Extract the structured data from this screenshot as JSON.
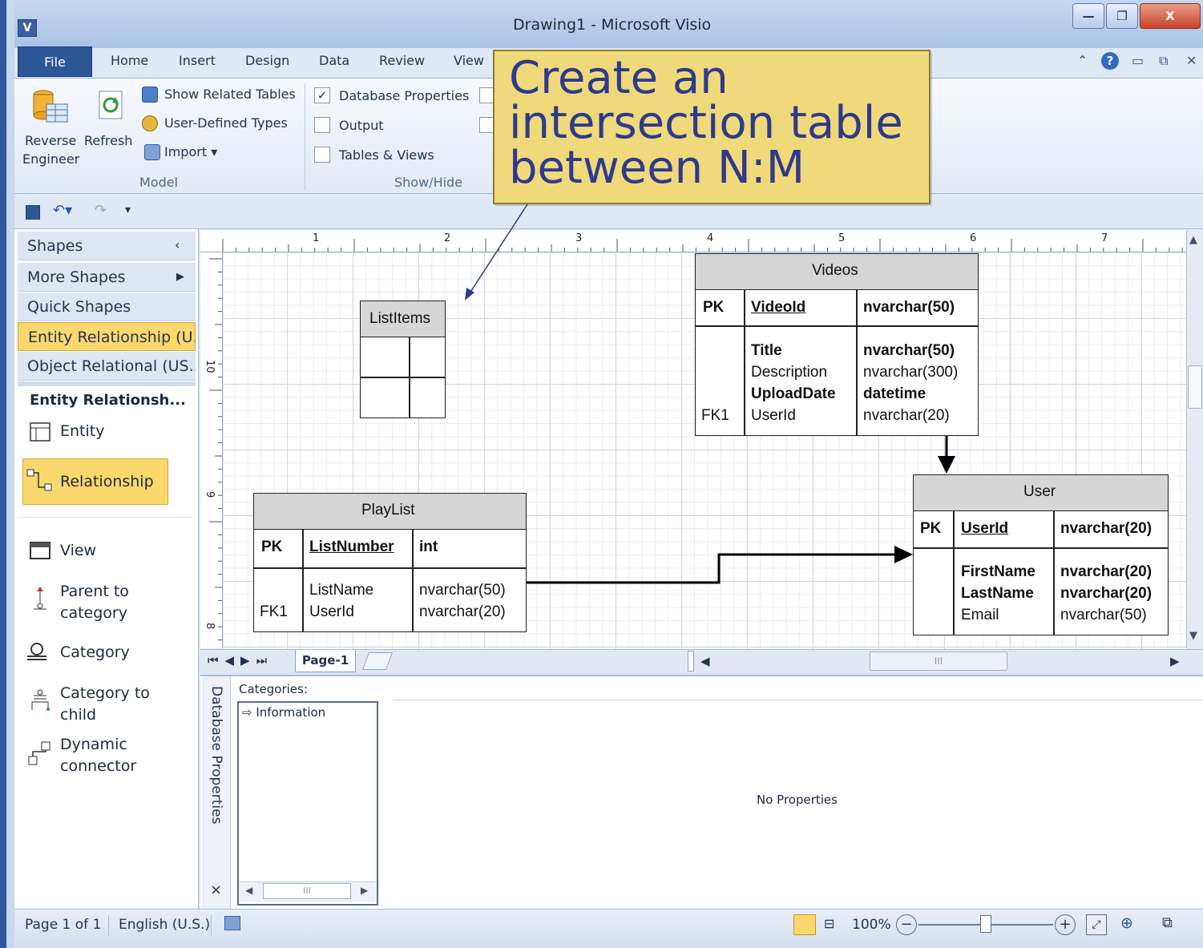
{
  "window": {
    "title": "Drawing1  -  Microsoft Visio",
    "app_icon": "V",
    "min": "—",
    "max": "❐",
    "close": "X"
  },
  "ribbon_tabs": [
    "File",
    "Home",
    "Insert",
    "Design",
    "Data",
    "Review",
    "View"
  ],
  "ribbon": {
    "reverse_engineer": [
      "Reverse",
      "Engineer"
    ],
    "refresh": "Refresh",
    "show_related_tables": "Show Related Tables",
    "user_defined_types": "User-Defined Types",
    "import": "Import ▾",
    "group_model": "Model",
    "database_properties": "Database Properties",
    "output": "Output",
    "tables_views": "Tables & Views",
    "group_showhide": "Show/Hide",
    "database_properties_checked": true
  },
  "callout": {
    "lines": [
      "Create an",
      "intersection table",
      "between N:M"
    ]
  },
  "shapes_pane": {
    "header": "Shapes",
    "more_shapes": "More Shapes",
    "quick_shapes": "Quick Shapes",
    "stencil_active": "Entity Relationship (U...",
    "stencil_other": "Object Relational (US...",
    "section_title": "Entity Relationsh...",
    "items": [
      {
        "name": "entity",
        "label": "Entity"
      },
      {
        "name": "relationship",
        "label": "Relationship"
      },
      {
        "name": "view",
        "label": "View"
      },
      {
        "name": "parent-to-category",
        "label1": "Parent to",
        "label2": "category"
      },
      {
        "name": "category",
        "label": "Category"
      },
      {
        "name": "category-to-child",
        "label1": "Category to",
        "label2": "child"
      },
      {
        "name": "dynamic-connector",
        "label1": "Dynamic",
        "label2": "connector"
      }
    ]
  },
  "ruler": {
    "top_labels": [
      "1",
      "2",
      "3",
      "4",
      "5",
      "6",
      "7"
    ],
    "left_labels": [
      "10",
      "9",
      "8"
    ]
  },
  "tables": {
    "videos": {
      "name": "Videos",
      "pk_label": "PK",
      "pk_field": "VideoId",
      "pk_type": "nvarchar(50)",
      "fk_label": "FK1",
      "fields": [
        "Title",
        "Description",
        "UploadDate",
        "UserId"
      ],
      "types": [
        "nvarchar(50)",
        "nvarchar(300)",
        "datetime",
        "nvarchar(20)"
      ]
    },
    "listitems": {
      "name": "ListItems"
    },
    "playlist": {
      "name": "PlayList",
      "pk_label": "PK",
      "pk_field": "ListNumber",
      "pk_type": "int",
      "fk_label": "FK1",
      "fields": [
        "ListName",
        "UserId"
      ],
      "types": [
        "nvarchar(50)",
        "nvarchar(20)"
      ]
    },
    "user": {
      "name": "User",
      "pk_label": "PK",
      "pk_field": "UserId",
      "pk_type": "nvarchar(20)",
      "fields": [
        "FirstName",
        "LastName",
        "Email"
      ],
      "types": [
        "nvarchar(20)",
        "nvarchar(20)",
        "nvarchar(50)"
      ]
    }
  },
  "page_tabs": {
    "current": "Page-1"
  },
  "db_properties": {
    "side_label": "Database Properties",
    "categories_label": "Categories:",
    "category_item": "⇨ Information",
    "no_props": "No Properties",
    "close": "×"
  },
  "status": {
    "page": "Page 1 of 1",
    "language": "English (U.S.)",
    "zoom": "100%"
  },
  "colors": {
    "accent": "#2b5797",
    "callout_fill": "#f0d97a",
    "callout_text": "#2e3a8c",
    "header_gray": "#d6d6d6",
    "stencil_highlight": "#fbd86e"
  }
}
